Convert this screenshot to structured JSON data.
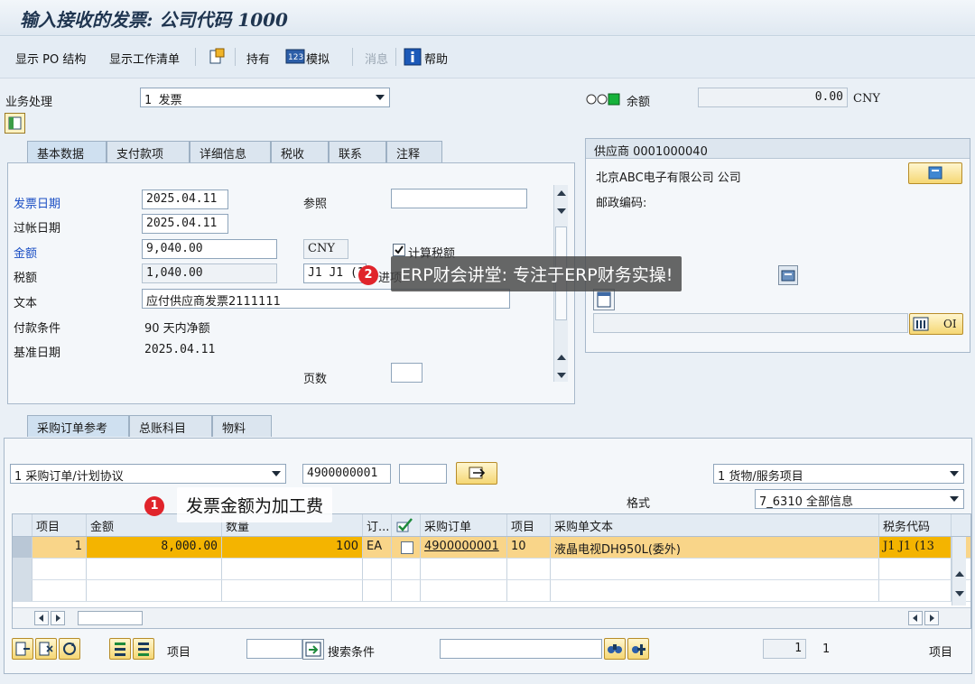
{
  "window": {
    "title": "输入接收的发票: 公司代码 1000"
  },
  "toolbar": {
    "show_po_structure": "显示 PO 结构",
    "show_worklist": "显示工作清单",
    "hold": "持有",
    "simulate": "模拟",
    "messages": "消息",
    "help": "帮助"
  },
  "header": {
    "transaction_label": "业务处理",
    "transaction_value": "1 发票",
    "balance_label": "余额",
    "balance_value": "0.00",
    "balance_currency": "CNY"
  },
  "basic_tabs": [
    "基本数据",
    "支付款项",
    "详细信息",
    "税收",
    "联系",
    "注释"
  ],
  "basic": {
    "invoice_date_label": "发票日期",
    "invoice_date": "2025.04.11",
    "reference_label": "参照",
    "reference_value": "",
    "posting_date_label": "过帐日期",
    "posting_date": "2025.04.11",
    "amount_label": "金额",
    "amount": "9,040.00",
    "currency": "CNY",
    "calc_tax_label": "计算税额",
    "tax_label": "税额",
    "tax_amount": "1,040.00",
    "tax_code": "J1 J1 (13",
    "tax_code_tail": "进项",
    "text_label": "文本",
    "text_value": "应付供应商发票2111111",
    "pay_terms_label": "付款条件",
    "pay_terms_value": "90 天内净额",
    "baseline_label": "基准日期",
    "baseline_date": "2025.04.11",
    "pages_label": "页数",
    "pages_value": ""
  },
  "vendor": {
    "title": "供应商 0001000040",
    "name": "北京ABC电子有限公司 公司",
    "postal_label": "邮政编码:",
    "oi_label": "OI"
  },
  "po_tabs": [
    "采购订单参考",
    "总账科目",
    "物料"
  ],
  "po": {
    "ref_type": "1 采购订单/计划协议",
    "po_number": "4900000001",
    "po_item": "",
    "layout_type": "1 货物/服务项目",
    "format_label": "格式",
    "format_value": "7_6310 全部信息"
  },
  "grid": {
    "headers": [
      "项目",
      "金额",
      "数量",
      "订...",
      "",
      "采购订单",
      "项目",
      "采购单文本",
      "税务代码"
    ],
    "rows": [
      {
        "item": "1",
        "amount": "8,000.00",
        "qty": "100",
        "unit": "EA",
        "po": "4900000001",
        "po_item": "10",
        "text": "液晶电视DH950L(委外)",
        "tax": "J1  J1 (13"
      }
    ]
  },
  "footer": {
    "item_label": "项目",
    "item_value": "",
    "search_label": "搜索条件",
    "search_value": "",
    "page_current": "1",
    "page_total": "1",
    "items_label": "项目"
  },
  "annotations": {
    "badge1": "1",
    "callout1": "发票金额为加工费",
    "badge2": "2",
    "callout2": "ERP财会讲堂: 专注于ERP财务实操!"
  }
}
